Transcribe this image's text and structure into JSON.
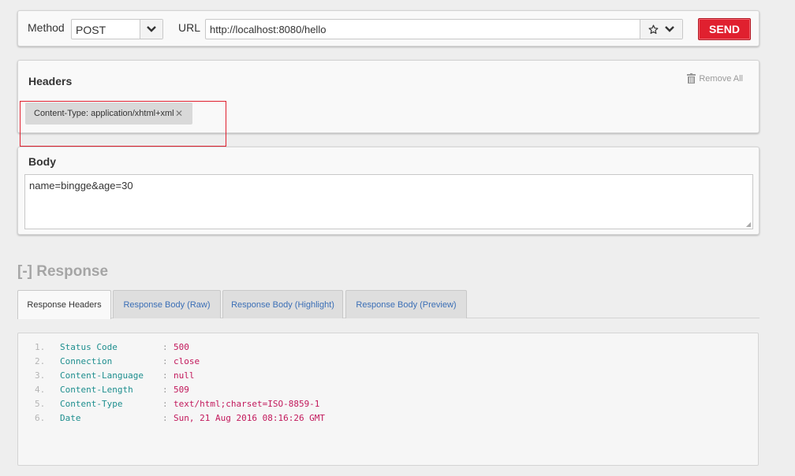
{
  "request": {
    "method_label": "Method",
    "method_value": "POST",
    "url_label": "URL",
    "url_value": "http://localhost:8080/hello",
    "send_label": "SEND"
  },
  "headers": {
    "title": "Headers",
    "remove_all_label": "Remove All",
    "items": [
      {
        "text": "Content-Type: application/xhtml+xml"
      }
    ]
  },
  "body": {
    "title": "Body",
    "content": "name=bingge&age=30"
  },
  "response": {
    "title": "[-] Response",
    "tabs": [
      {
        "label": "Response Headers",
        "active": true
      },
      {
        "label": "Response Body (Raw)",
        "active": false
      },
      {
        "label": "Response Body (Highlight)",
        "active": false
      },
      {
        "label": "Response Body (Preview)",
        "active": false
      }
    ],
    "rows": [
      {
        "num": "1.",
        "key": "Status Code",
        "value": "500"
      },
      {
        "num": "2.",
        "key": "Connection",
        "value": "close"
      },
      {
        "num": "3.",
        "key": "Content-Language",
        "value": "null"
      },
      {
        "num": "4.",
        "key": "Content-Length",
        "value": "509"
      },
      {
        "num": "5.",
        "key": "Content-Type",
        "value": "text/html;charset=ISO-8859-1"
      },
      {
        "num": "6.",
        "key": "Date",
        "value": "Sun, 21 Aug 2016 08:16:26 GMT"
      }
    ]
  },
  "colors": {
    "send_button": "#e0202f",
    "highlight_box": "#e0202f",
    "response_key": "#1d8e8e",
    "response_value": "#c2185b",
    "tab_link": "#3b6fb6"
  },
  "icons": {
    "method_dropdown": "chevron-down-icon",
    "favorite": "star-icon",
    "url_history": "chevron-down-icon",
    "remove_all": "trash-icon",
    "chip_remove": "close-icon"
  }
}
